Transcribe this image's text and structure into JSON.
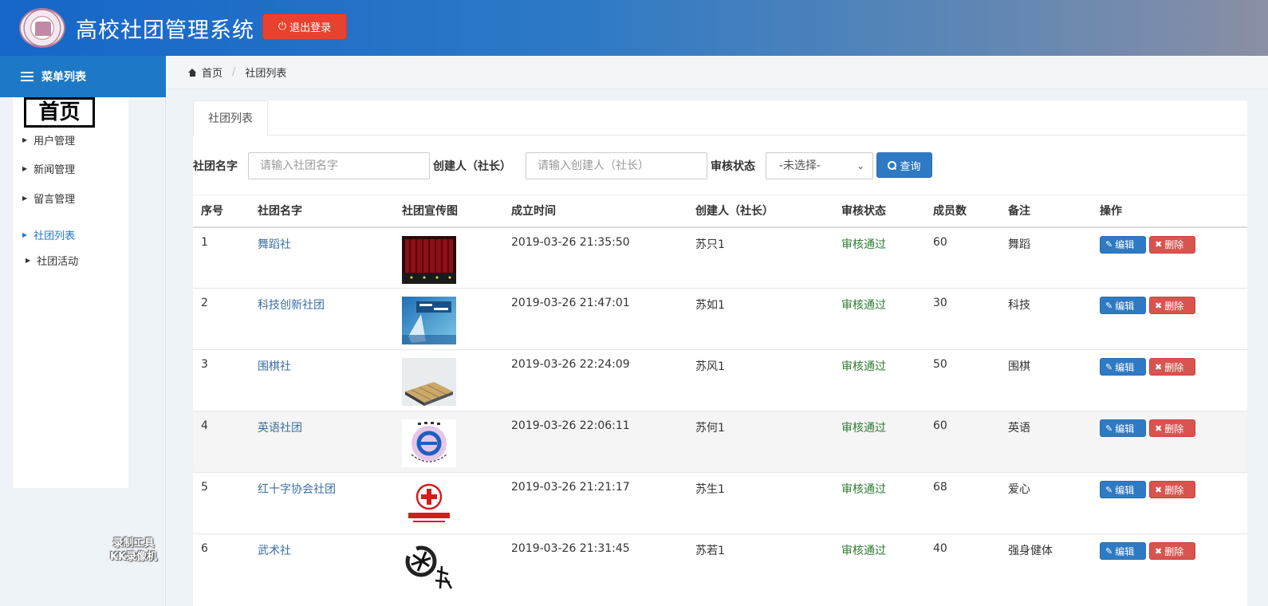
{
  "header": {
    "title": "高校社团管理系统",
    "logout_label": "退出登录"
  },
  "sidebar": {
    "menu_title": "菜单列表",
    "home_label": "首页",
    "items": [
      {
        "label": "用户管理"
      },
      {
        "label": "新闻管理"
      },
      {
        "label": "留言管理"
      },
      {
        "label": "社团列表"
      },
      {
        "label": "社团活动"
      }
    ]
  },
  "watermark": {
    "line1": "录制工具",
    "line2": "KK录像机"
  },
  "breadcrumb": {
    "home": "首页",
    "current": "社团列表"
  },
  "panel": {
    "tab_label": "社团列表"
  },
  "search": {
    "name_label": "社团名字",
    "name_placeholder": "请输入社团名字",
    "creator_label": "创建人（社长）",
    "creator_placeholder": "请输入创建人（社长）",
    "status_label": "审核状态",
    "status_selected": "-未选择-",
    "query_label": "查询"
  },
  "table": {
    "columns": [
      "序号",
      "社团名字",
      "社团宣传图",
      "成立时间",
      "创建人（社长）",
      "审核状态",
      "成员数",
      "备注",
      "操作"
    ],
    "edit_label": "编辑",
    "delete_label": "删除",
    "rows": [
      {
        "index": "1",
        "name": "舞蹈社",
        "image": "stage-curtain",
        "founded": "2019-03-26 21:35:50",
        "creator": "苏只1",
        "status": "审核通过",
        "members": "60",
        "note": "舞蹈"
      },
      {
        "index": "2",
        "name": "科技创新社团",
        "image": "tech-poster",
        "founded": "2019-03-26 21:47:01",
        "creator": "苏如1",
        "status": "审核通过",
        "members": "30",
        "note": "科技"
      },
      {
        "index": "3",
        "name": "围棋社",
        "image": "go-board",
        "founded": "2019-03-26 22:24:09",
        "creator": "苏风1",
        "status": "审核通过",
        "members": "50",
        "note": "围棋"
      },
      {
        "index": "4",
        "name": "英语社团",
        "image": "english-logo",
        "founded": "2019-03-26 22:06:11",
        "creator": "苏何1",
        "status": "审核通过",
        "members": "60",
        "note": "英语"
      },
      {
        "index": "5",
        "name": "红十字协会社团",
        "image": "red-cross-logo",
        "founded": "2019-03-26 21:21:17",
        "creator": "苏生1",
        "status": "审核通过",
        "members": "68",
        "note": "爱心"
      },
      {
        "index": "6",
        "name": "武术社",
        "image": "martial-arts-calligraphy",
        "founded": "2019-03-26 21:31:45",
        "creator": "苏若1",
        "status": "审核通过",
        "members": "40",
        "note": "强身健体"
      }
    ]
  },
  "colors": {
    "header_start": "#1566c8",
    "header_end": "#8a8fa5",
    "menu_header": "#1d79c7",
    "logout": "#e8412f",
    "primary": "#2f7ac4",
    "danger": "#d9534f",
    "status_ok": "#2e7d32",
    "link": "#3a6ea5"
  }
}
